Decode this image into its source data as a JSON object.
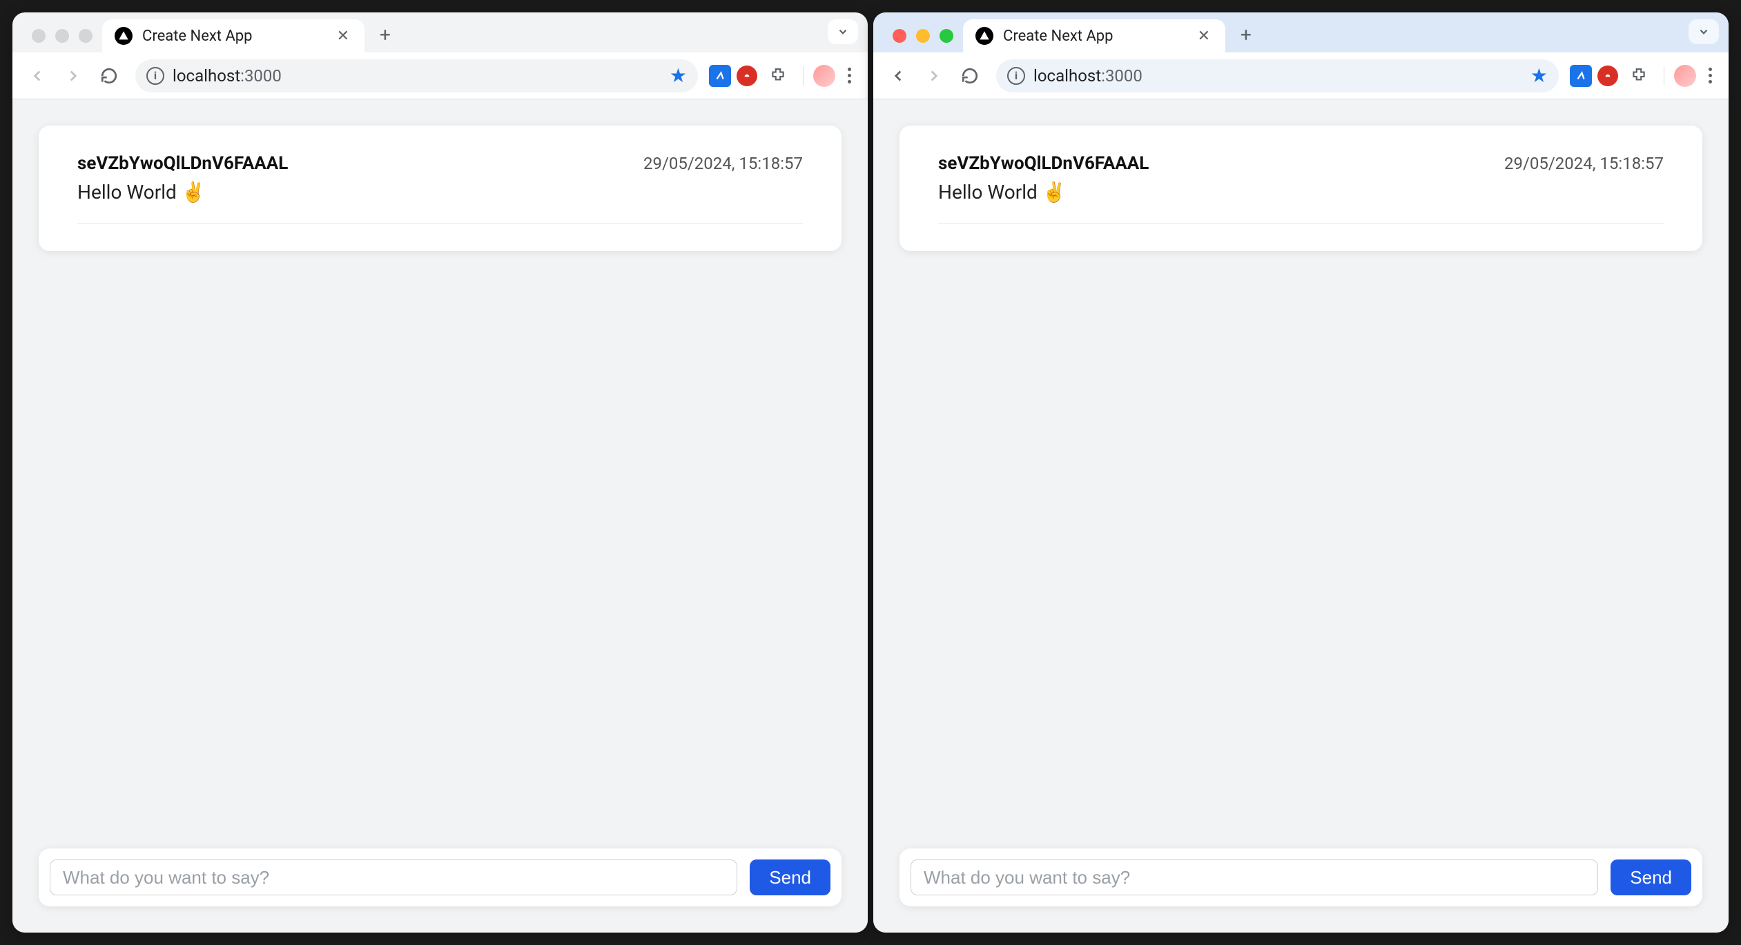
{
  "windows": [
    {
      "traffic_active": false,
      "tab": {
        "title": "Create Next App"
      },
      "url": {
        "host": "localhost",
        "port": ":3000"
      },
      "message": {
        "user": "seVZbYwoQlLDnV6FAAAL",
        "time": "29/05/2024, 15:18:57",
        "body": "Hello World ✌️"
      },
      "composer": {
        "placeholder": "What do you want to say?",
        "send_label": "Send"
      }
    },
    {
      "traffic_active": true,
      "tab": {
        "title": "Create Next App"
      },
      "url": {
        "host": "localhost",
        "port": ":3000"
      },
      "message": {
        "user": "seVZbYwoQlLDnV6FAAAL",
        "time": "29/05/2024, 15:18:57",
        "body": "Hello World ✌️"
      },
      "composer": {
        "placeholder": "What do you want to say?",
        "send_label": "Send"
      }
    }
  ]
}
